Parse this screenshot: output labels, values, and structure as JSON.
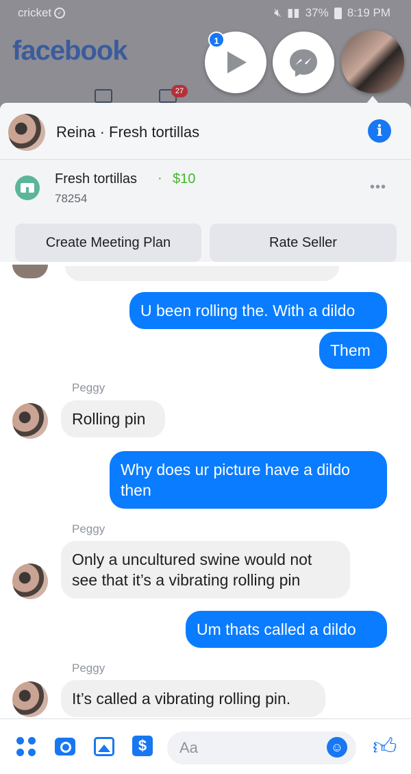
{
  "status_bar": {
    "carrier": "cricket",
    "battery": "37%",
    "time": "8:19 PM"
  },
  "app": {
    "wordmark": "facebook",
    "tab_badge": "27"
  },
  "chat_heads": {
    "badge": "1"
  },
  "thread": {
    "title": "Reina · Fresh tortillas",
    "listing": {
      "title": "Fresh tortillas",
      "separator": "·",
      "price": "$10",
      "zip": "78254"
    },
    "buttons": {
      "meeting": "Create Meeting Plan",
      "rate": "Rate Seller"
    }
  },
  "messages": [
    {
      "direction": "out",
      "text": "U been rolling the. With a dildo"
    },
    {
      "direction": "out",
      "text": "Them"
    },
    {
      "direction": "in",
      "sender": "Peggy",
      "text": "Rolling pin"
    },
    {
      "direction": "out",
      "text": "Why does ur picture have a dildo then"
    },
    {
      "direction": "in",
      "sender": "Peggy",
      "text": "Only a uncultured swine would not see that it’s a vibrating rolling pin"
    },
    {
      "direction": "out",
      "text": "Um thats called a dildo"
    },
    {
      "direction": "in",
      "sender": "Peggy",
      "text": "It’s called a vibrating rolling pin."
    }
  ],
  "composer": {
    "placeholder": "Aa",
    "pay_symbol": "$"
  },
  "colors": {
    "accent": "#1877f2",
    "outgoing_bubble": "#0a7cff",
    "incoming_bubble": "#f1f0f0",
    "price": "#42b72a",
    "dim_background": "#8d8d93"
  }
}
